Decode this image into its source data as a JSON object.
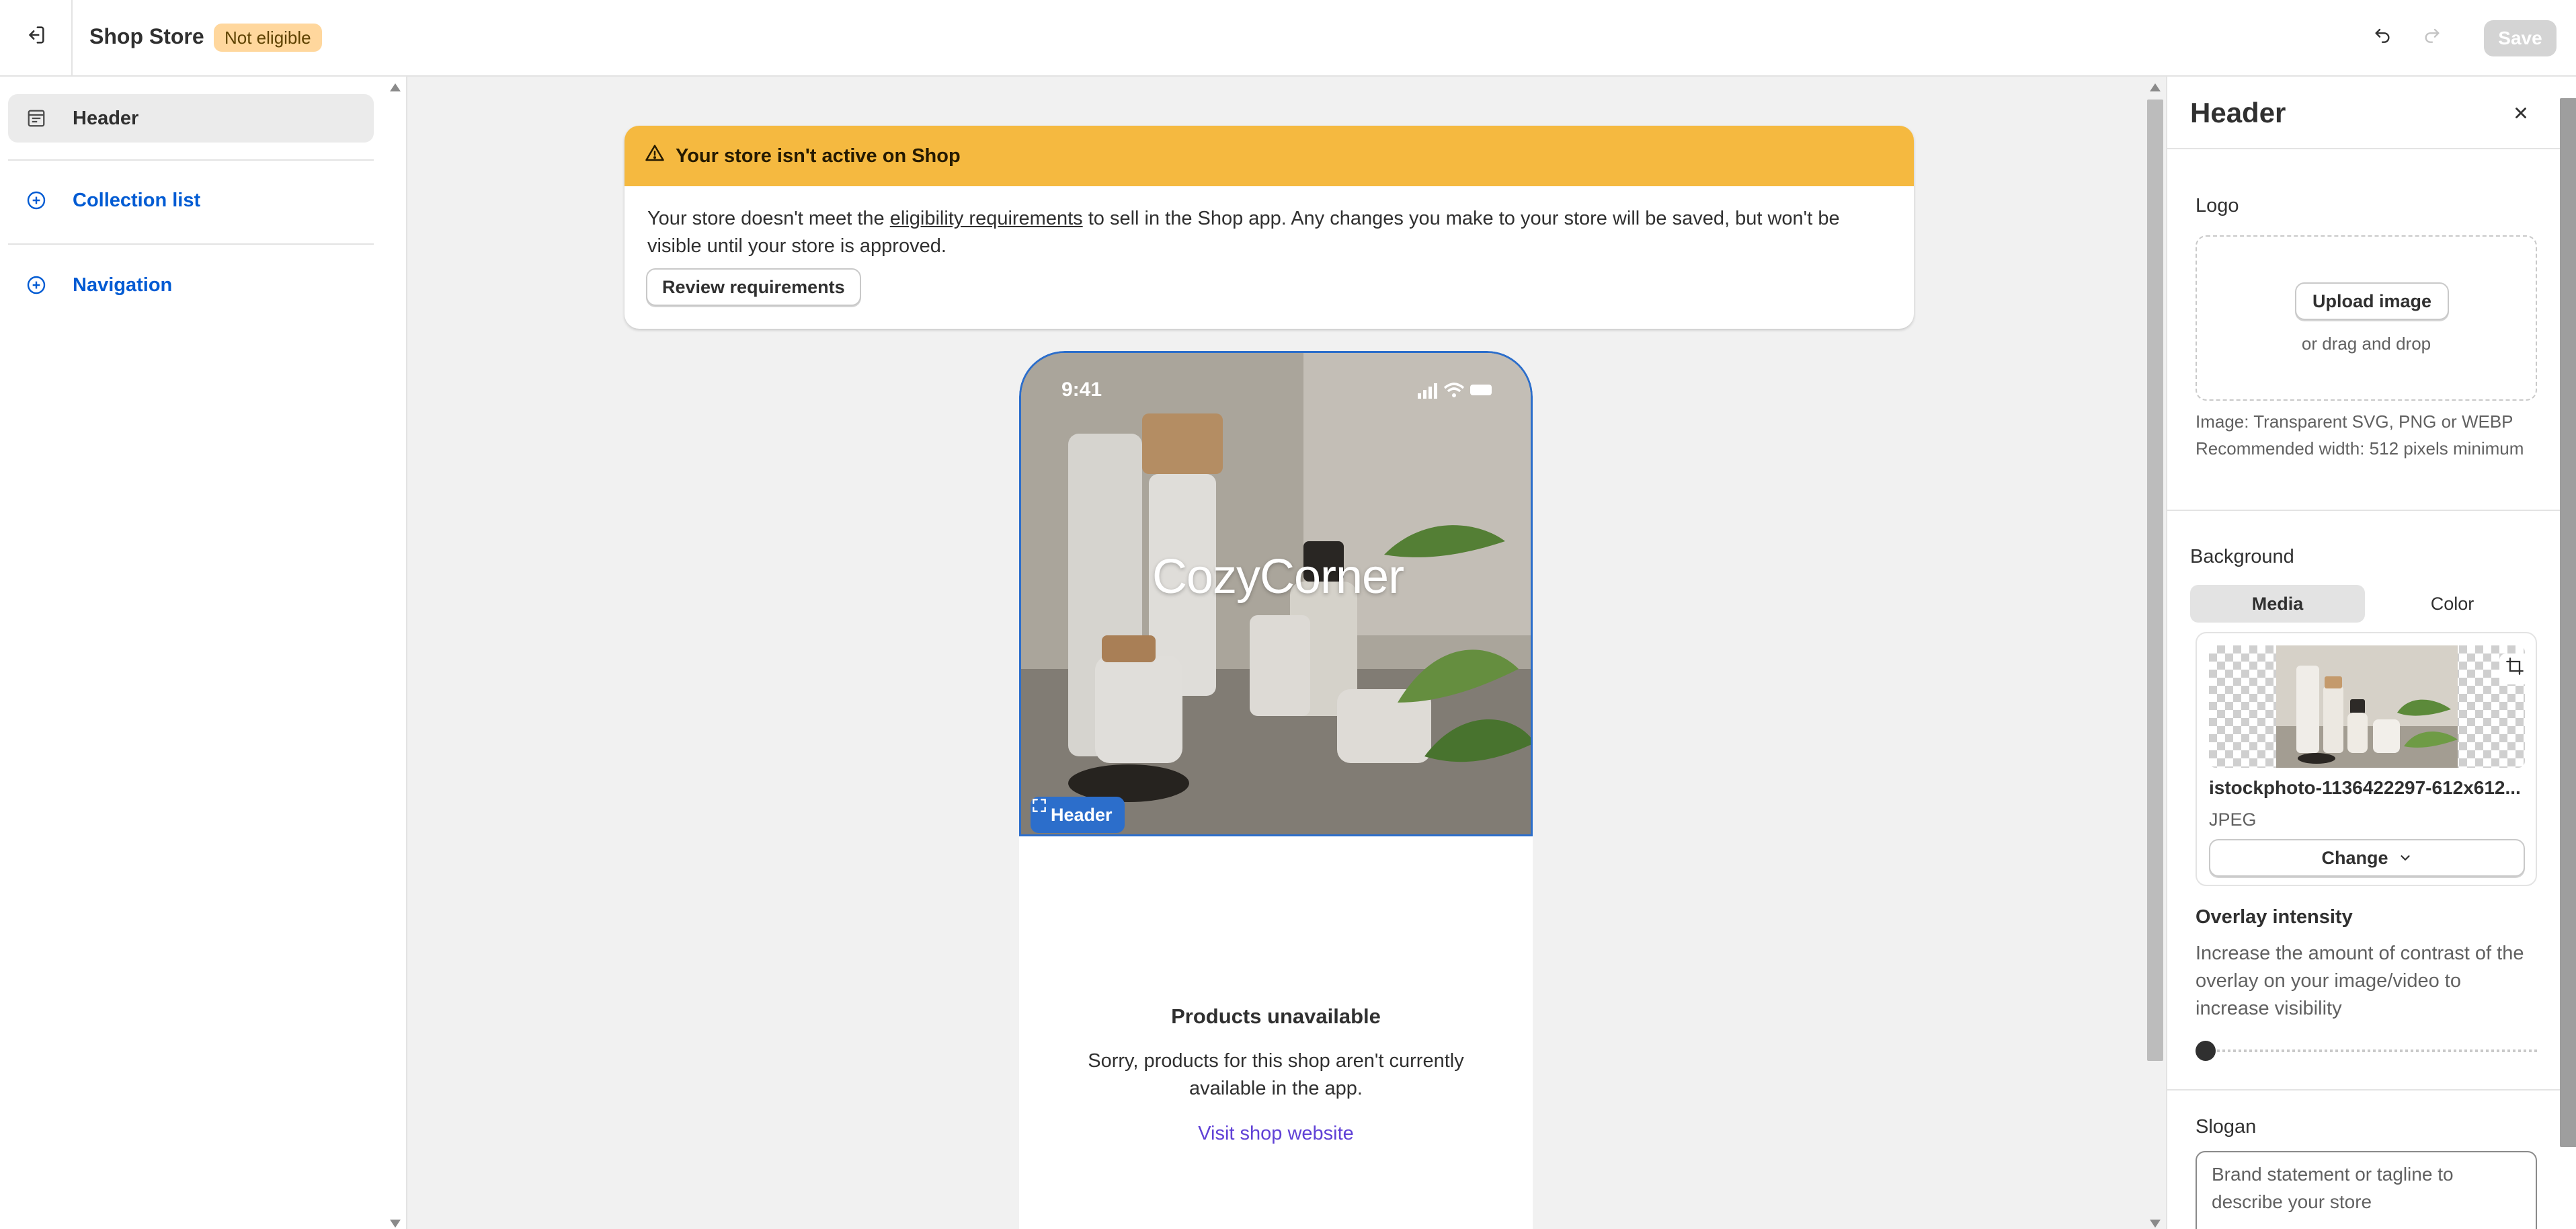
{
  "topbar": {
    "store_name": "Shop Store",
    "status_badge": "Not eligible",
    "save_label": "Save"
  },
  "sidebar": {
    "items": [
      {
        "label": "Header",
        "icon": "header-layout-icon",
        "state": "selected"
      },
      {
        "label": "Collection list",
        "icon": "add-circle-icon",
        "state": "add"
      },
      {
        "label": "Navigation",
        "icon": "add-circle-icon",
        "state": "add"
      }
    ]
  },
  "banner": {
    "title": "Your store isn't active on Shop",
    "body_before": "Your store doesn't meet the ",
    "body_link": "eligibility requirements",
    "body_after": " to sell in the Shop app. Any changes you make to your store will be saved, but won't be visible until your store is approved.",
    "button": "Review requirements",
    "color": "#f5b940"
  },
  "preview": {
    "status_time": "9:41",
    "brand_name": "CozyCorner",
    "selected_tag": "Header",
    "empty_title": "Products unavailable",
    "empty_body": "Sorry, products for this shop aren't currently available in the app.",
    "link": "Visit shop website",
    "accent": "#2c6ecb"
  },
  "panel": {
    "title": "Header",
    "logo": {
      "label": "Logo",
      "upload_button": "Upload image",
      "drag_text": "or drag and drop",
      "hint_format": "Image: Transparent SVG, PNG or WEBP",
      "hint_width": "Recommended width: 512 pixels minimum"
    },
    "background": {
      "label": "Background",
      "tabs": [
        "Media",
        "Color"
      ],
      "selected_tab": "Media",
      "file_name": "istockphoto-1136422297-612x612...",
      "file_type": "JPEG",
      "change_button": "Change"
    },
    "overlay": {
      "label": "Overlay intensity",
      "description": "Increase the amount of contrast of the overlay on your image/video to increase visibility",
      "value": 0
    },
    "slogan": {
      "label": "Slogan",
      "placeholder": "Brand statement or tagline to describe your store"
    }
  }
}
